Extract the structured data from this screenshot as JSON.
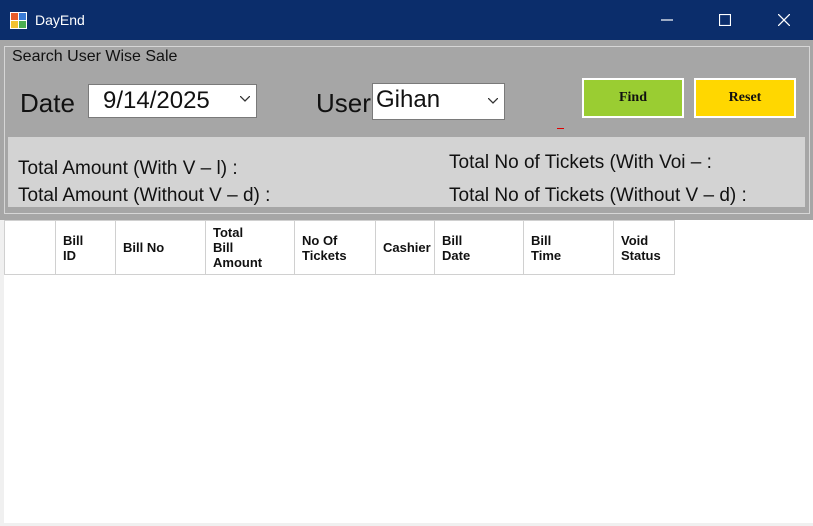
{
  "window": {
    "title": "DayEnd"
  },
  "group": {
    "caption": "Search User Wise Sale"
  },
  "filters": {
    "date_label": "Date",
    "date_value": "9/14/2025",
    "user_label": "User",
    "user_value": "Gihan"
  },
  "buttons": {
    "find": "Find",
    "reset": "Reset"
  },
  "colors": {
    "titlebar": "#0b2d6b",
    "find": "#9acd32",
    "reset": "#ffd700",
    "panel": "#a6a6a6"
  },
  "totals": {
    "amount_with_void": "Total Amount (With V – l) :",
    "amount_without_void": "Total Amount (Without V – d) :",
    "tickets_with_void": "Total No of Tickets (With Voi – :",
    "tickets_without_void": "Total No of Tickets (Without V – d) :"
  },
  "grid": {
    "columns": [
      "",
      "Bill\nID",
      "Bill No",
      "Total\nBill\nAmount",
      "No Of\nTickets",
      "Cashier",
      "Bill\nDate",
      "Bill\nTime",
      "Void\nStatus"
    ]
  }
}
